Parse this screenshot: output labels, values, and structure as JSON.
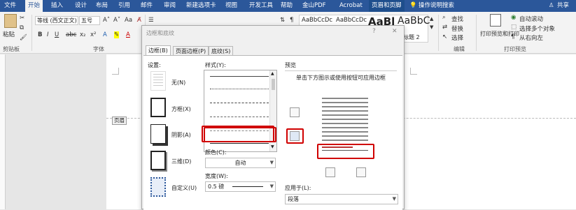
{
  "tabs": [
    "文件",
    "开始",
    "插入",
    "设计",
    "布局",
    "引用",
    "邮件",
    "审阅",
    "新建选项卡",
    "视图",
    "开发工具",
    "帮助",
    "金山PDF",
    "Acrobat",
    "页眉和页脚",
    "操作说明搜索",
    "共享"
  ],
  "ribbon": {
    "paste_label": "粘贴",
    "clipboard_group": "剪贴板",
    "font_name": "等线 (西文正文)",
    "font_size": "五号",
    "font_group": "字体",
    "styles": [
      "AaBbCcDc",
      "AaBbCcDc",
      "AaBl",
      "AaBbC"
    ],
    "style_caption": "标题 2",
    "find_label": "查找",
    "replace_label": "替换",
    "select_label": "选择",
    "editing_group": "编辑",
    "print_preview_label": "打印预览和打印",
    "auto_scroll": "自动滚动",
    "select_multi": "选择多个对象",
    "rtl": "从右向左",
    "print_preview_group": "打印预览"
  },
  "document": {
    "header_label": "页眉"
  },
  "dialog": {
    "title": "边框和底纹",
    "help_button": "?",
    "close_button": "✕",
    "tabs": [
      "边框(B)",
      "页面边框(P)",
      "底纹(S)"
    ],
    "setting_label": "设置:",
    "settings": [
      "无(N)",
      "方框(X)",
      "阴影(A)",
      "三维(D)",
      "自定义(U)"
    ],
    "style_label": "样式(Y):",
    "color_label": "颜色(C):",
    "color_value": "自动",
    "width_label": "宽度(W):",
    "width_value": "0.5 磅",
    "preview_label": "预览",
    "preview_hint": "单击下方图示或使用按钮可应用边框",
    "apply_label": "应用于(L):",
    "apply_value": "段落"
  },
  "colors": {
    "ribbon_blue": "#2b579a",
    "highlight_red": "#d00000"
  }
}
